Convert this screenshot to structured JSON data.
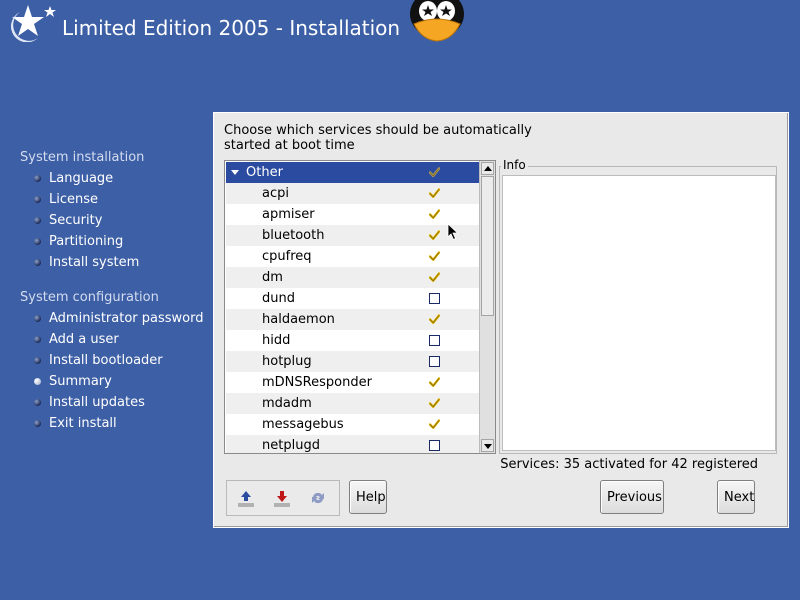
{
  "header": {
    "title": "Limited Edition 2005 - Installation"
  },
  "sidebar": {
    "section_installation": "System installation",
    "installation_items": [
      {
        "label": "Language"
      },
      {
        "label": "License"
      },
      {
        "label": "Security"
      },
      {
        "label": "Partitioning"
      },
      {
        "label": "Install system"
      }
    ],
    "section_configuration": "System configuration",
    "configuration_items": [
      {
        "label": "Administrator password"
      },
      {
        "label": "Add a user"
      },
      {
        "label": "Install bootloader"
      },
      {
        "label": "Summary",
        "current": true
      },
      {
        "label": "Install updates"
      },
      {
        "label": "Exit install"
      }
    ]
  },
  "main": {
    "instruction": "Choose which services should be automatically started at boot time",
    "tree": {
      "group": "Other",
      "services": [
        {
          "name": "acpi",
          "enabled": true
        },
        {
          "name": "apmiser",
          "enabled": true
        },
        {
          "name": "bluetooth",
          "enabled": true
        },
        {
          "name": "cpufreq",
          "enabled": true
        },
        {
          "name": "dm",
          "enabled": true
        },
        {
          "name": "dund",
          "enabled": false
        },
        {
          "name": "haldaemon",
          "enabled": true
        },
        {
          "name": "hidd",
          "enabled": false
        },
        {
          "name": "hotplug",
          "enabled": false
        },
        {
          "name": "mDNSResponder",
          "enabled": true
        },
        {
          "name": "mdadm",
          "enabled": true
        },
        {
          "name": "messagebus",
          "enabled": true
        },
        {
          "name": "netplugd",
          "enabled": false
        }
      ]
    },
    "info_label": "Info",
    "status": "Services: 35 activated for 42 registered"
  },
  "buttons": {
    "help": "Help",
    "previous": "Previous",
    "next": "Next"
  },
  "colors": {
    "background": "#3d5fa6",
    "selection": "#2b4ba0",
    "checkmark": "#e0b400"
  }
}
